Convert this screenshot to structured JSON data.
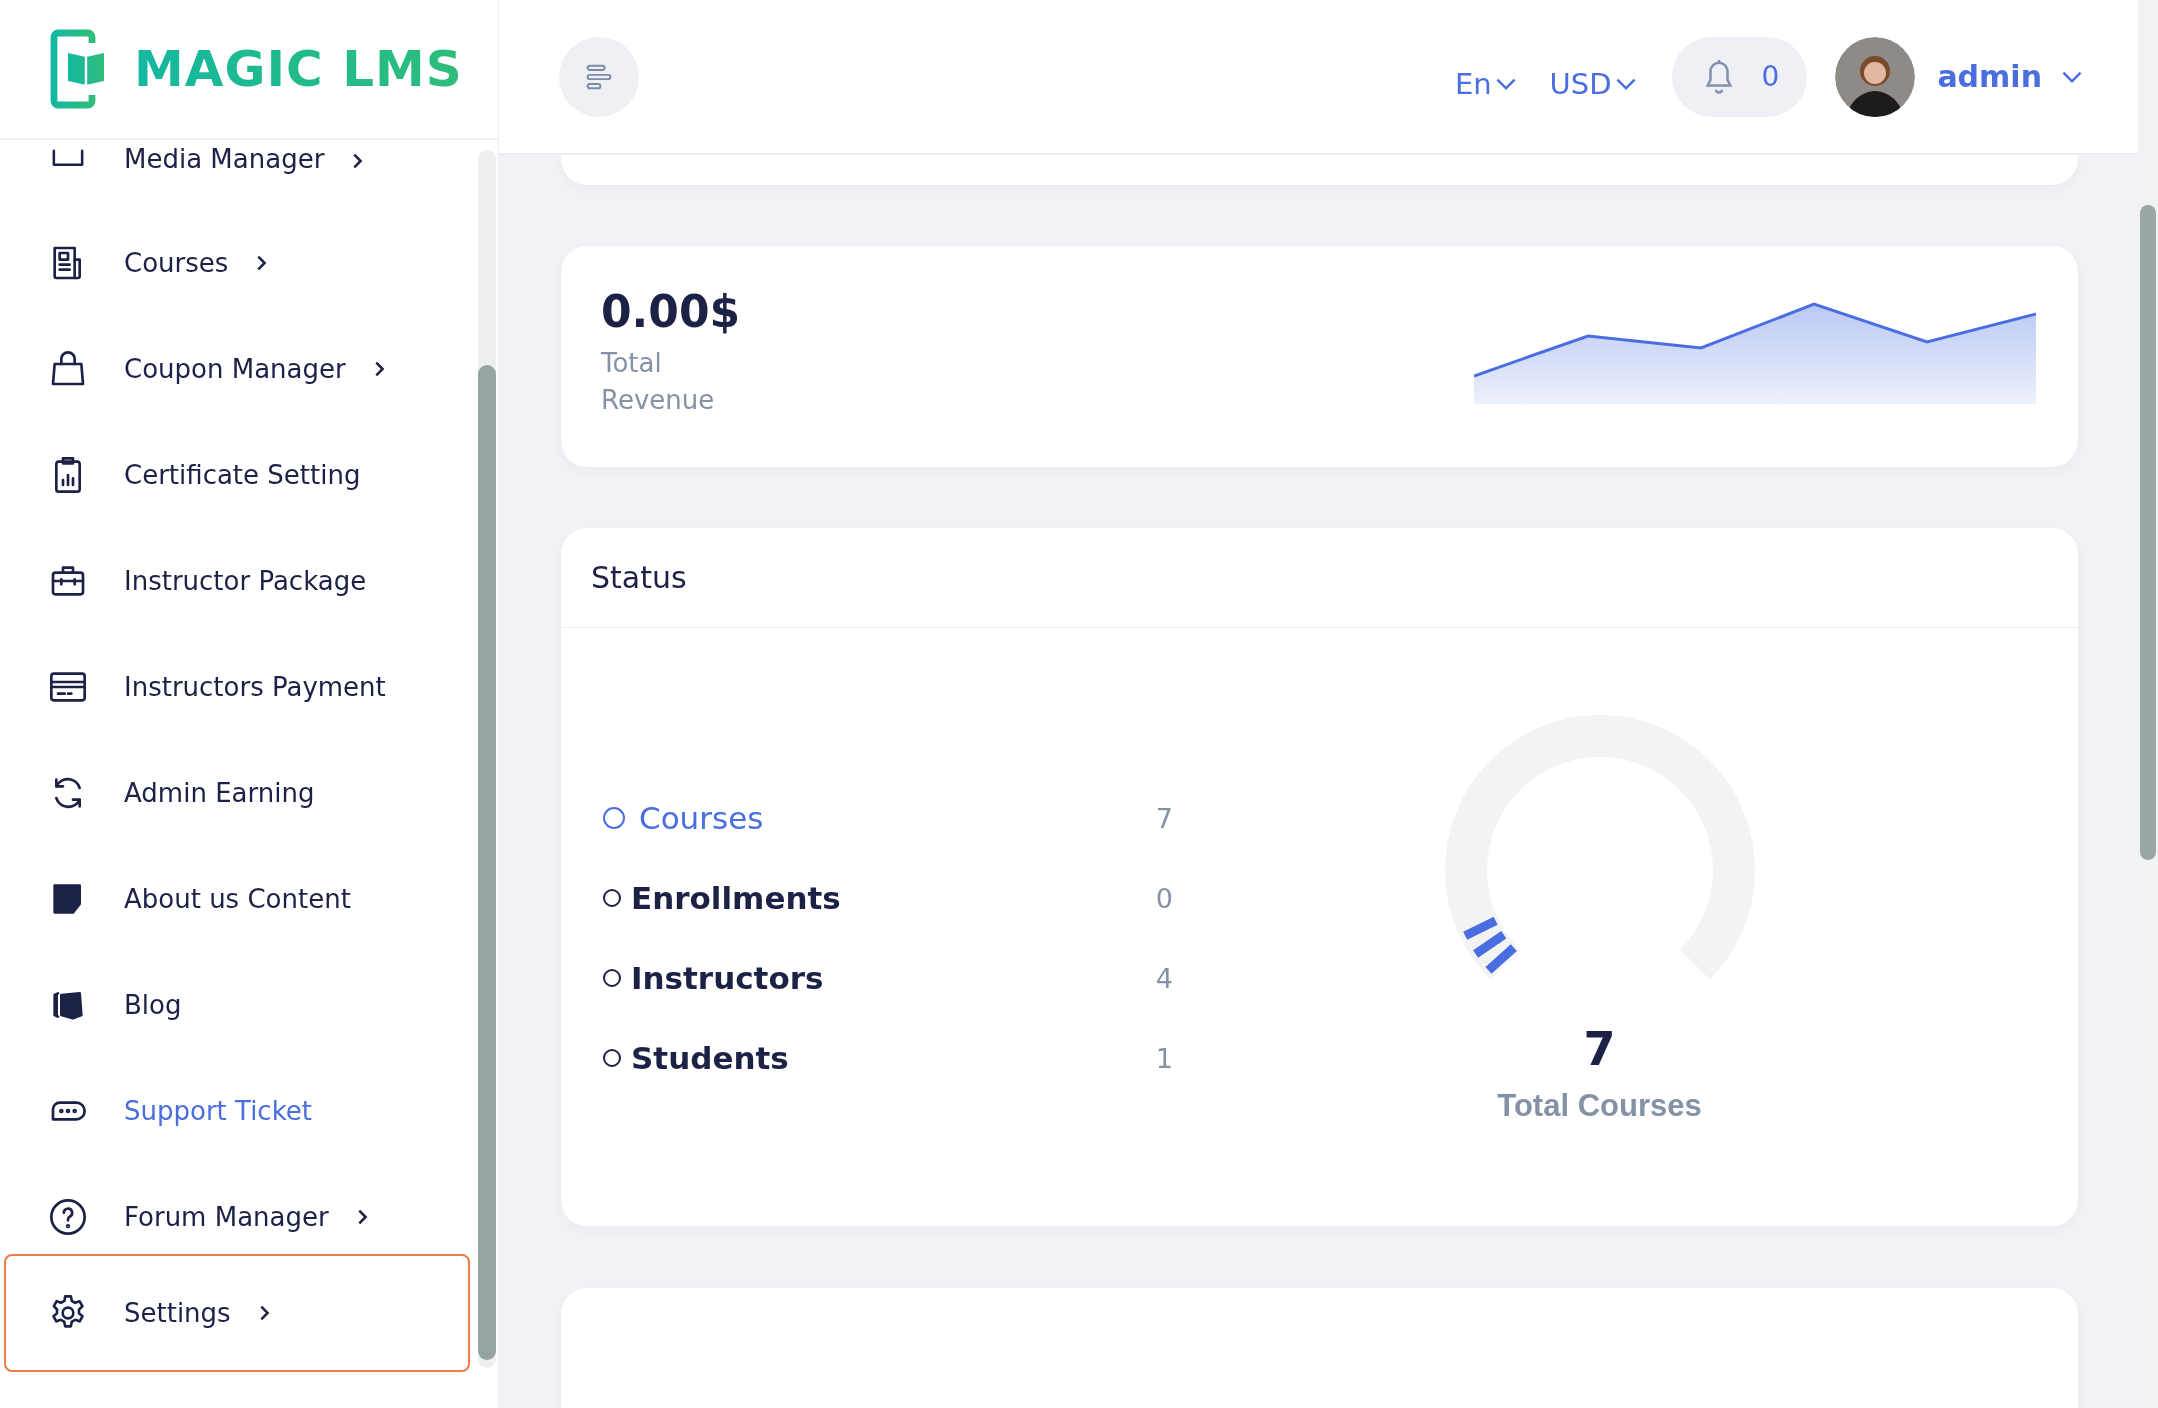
{
  "logo": {
    "text": "MAGIC LMS"
  },
  "sidebar": {
    "items": [
      {
        "label": "Media Manager",
        "expandable": true,
        "active": false,
        "focused": false
      },
      {
        "label": "Courses",
        "expandable": true,
        "active": false,
        "focused": false
      },
      {
        "label": "Coupon Manager",
        "expandable": true,
        "active": false,
        "focused": false
      },
      {
        "label": "Certificate Setting",
        "expandable": false,
        "active": false,
        "focused": false
      },
      {
        "label": "Instructor Package",
        "expandable": false,
        "active": false,
        "focused": false
      },
      {
        "label": "Instructors Payment",
        "expandable": false,
        "active": false,
        "focused": false
      },
      {
        "label": "Admin Earning",
        "expandable": false,
        "active": false,
        "focused": false
      },
      {
        "label": "About us Content",
        "expandable": false,
        "active": false,
        "focused": false
      },
      {
        "label": "Blog",
        "expandable": false,
        "active": false,
        "focused": false
      },
      {
        "label": "Support Ticket",
        "expandable": false,
        "active": true,
        "focused": false
      },
      {
        "label": "Forum Manager",
        "expandable": true,
        "active": false,
        "focused": false
      },
      {
        "label": "Settings",
        "expandable": true,
        "active": false,
        "focused": true
      }
    ]
  },
  "header": {
    "language": "En",
    "currency": "USD",
    "notifications": "0",
    "user": "admin"
  },
  "revenue": {
    "amount": "0.00$",
    "label": "Total Revenue"
  },
  "status": {
    "title": "Status",
    "items": [
      {
        "label": "Courses",
        "count": "7",
        "selected": true
      },
      {
        "label": "Enrollments",
        "count": "0",
        "selected": false
      },
      {
        "label": "Instructors",
        "count": "4",
        "selected": false
      },
      {
        "label": "Students",
        "count": "1",
        "selected": false
      }
    ],
    "total": "7",
    "total_label": "Total Courses"
  }
}
